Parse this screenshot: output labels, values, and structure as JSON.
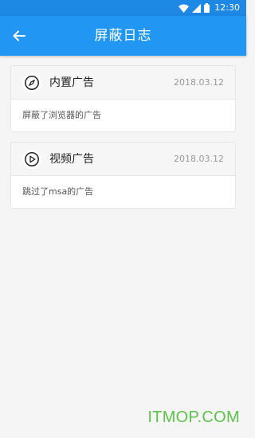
{
  "status": {
    "time": "12:30"
  },
  "appbar": {
    "title": "屏蔽日志"
  },
  "logs": [
    {
      "icon": "compass-icon",
      "title": "内置广告",
      "date": "2018.03.12",
      "desc": "屏蔽了浏览器的广告"
    },
    {
      "icon": "play-icon",
      "title": "视频广告",
      "date": "2018.03.12",
      "desc": "跳过了msa的广告"
    }
  ],
  "watermark": "ITMOP.COM",
  "colors": {
    "appbar": "#2196f3",
    "statusbar": "#1e88e5",
    "watermark": "#5cc24a"
  }
}
